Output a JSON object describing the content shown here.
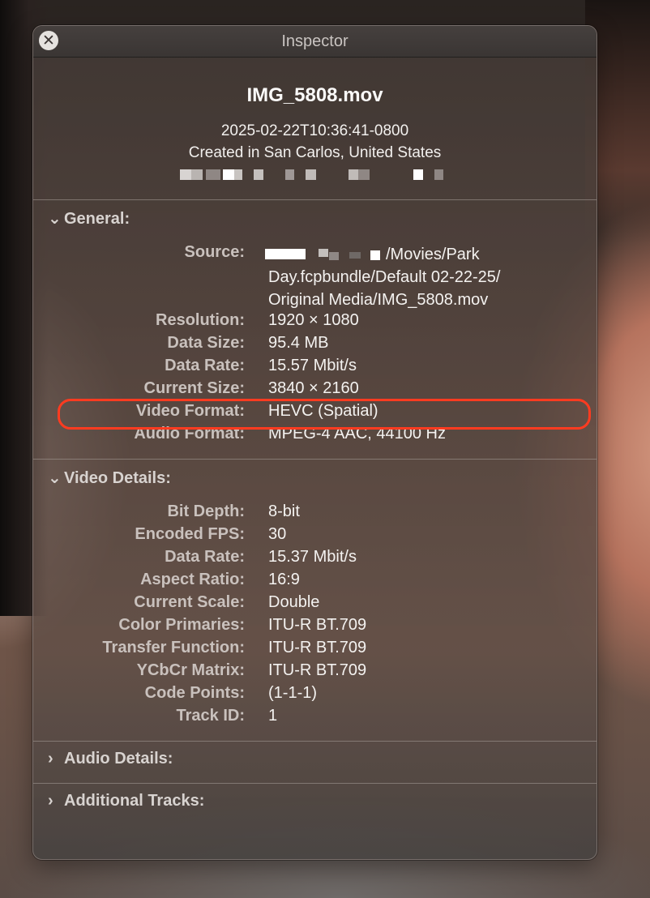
{
  "window": {
    "title": "Inspector",
    "close_symbol": "✕"
  },
  "file": {
    "name": "IMG_5808.mov",
    "timestamp": "2025-02-22T10:36:41-0800",
    "location": "Created in San Carlos, United States"
  },
  "sections": {
    "general": {
      "title": "General:",
      "expanded": true,
      "source_label": "Source:",
      "source_lines": [
        "/Movies/Park",
        "Day.fcpbundle/Default 02-22-25/",
        "Original Media/IMG_5808.mov"
      ],
      "rows": [
        {
          "label": "Resolution:",
          "value": "1920 × 1080"
        },
        {
          "label": "Data Size:",
          "value": "95.4 MB"
        },
        {
          "label": "Data Rate:",
          "value": "15.57 Mbit/s"
        },
        {
          "label": "Current Size:",
          "value": "3840 × 2160"
        },
        {
          "label": "Video Format:",
          "value": "HEVC (Spatial)"
        },
        {
          "label": "Audio Format:",
          "value": "MPEG-4 AAC, 44100 Hz"
        }
      ]
    },
    "video_details": {
      "title": "Video Details:",
      "expanded": true,
      "rows": [
        {
          "label": "Bit Depth:",
          "value": "8-bit"
        },
        {
          "label": "Encoded FPS:",
          "value": "30"
        },
        {
          "label": "Data Rate:",
          "value": "15.37 Mbit/s"
        },
        {
          "label": "Aspect Ratio:",
          "value": "16:9"
        },
        {
          "label": "Current Scale:",
          "value": "Double"
        },
        {
          "label": "Color Primaries:",
          "value": "ITU-R BT.709"
        },
        {
          "label": "Transfer Function:",
          "value": "ITU-R BT.709"
        },
        {
          "label": "YCbCr Matrix:",
          "value": "ITU-R BT.709"
        },
        {
          "label": "Code Points:",
          "value": "(1-1-1)"
        },
        {
          "label": "Track ID:",
          "value": "1"
        }
      ]
    },
    "audio_details": {
      "title": "Audio Details:",
      "expanded": false
    },
    "additional_tracks": {
      "title": "Additional Tracks:",
      "expanded": false
    }
  },
  "annotation": {
    "highlight_color": "#ff3b20",
    "highlighted_field": "Video Format:"
  },
  "colors": {
    "panel_bg": "#4e423d",
    "label": "#c9c1bd",
    "value": "#f4f2f0"
  }
}
